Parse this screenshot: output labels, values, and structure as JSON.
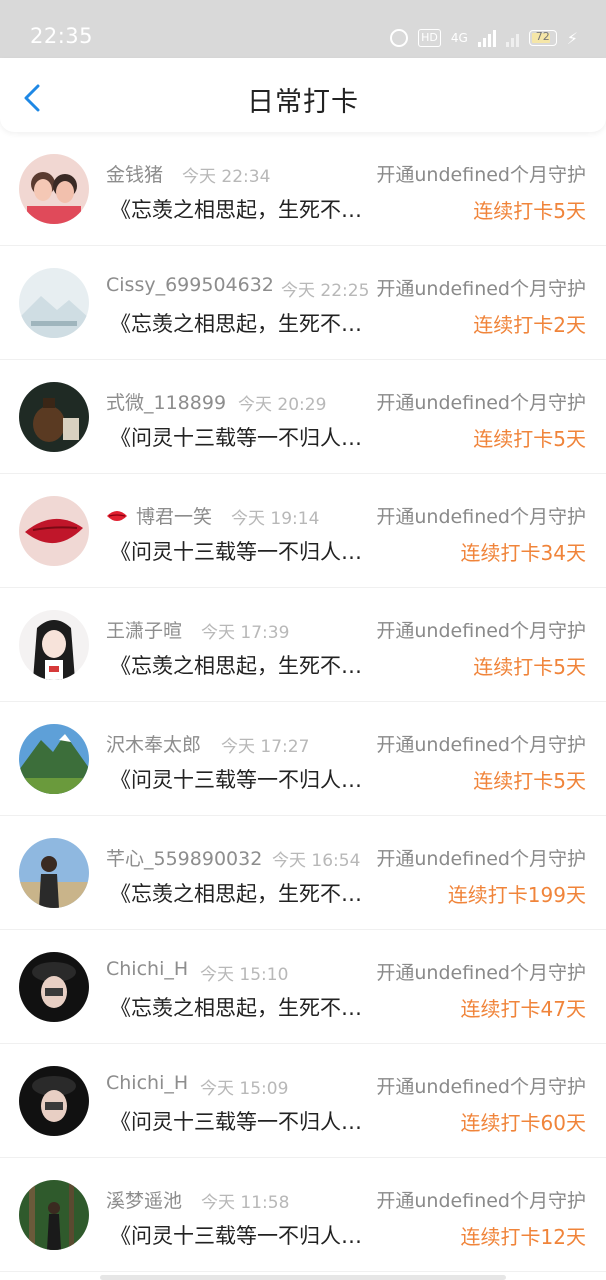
{
  "status_bar": {
    "time": "22:35",
    "hd": "HD",
    "network": "4G",
    "battery": "72"
  },
  "header": {
    "title": "日常打卡"
  },
  "entries": [
    {
      "name": "金钱猪",
      "time": "今天 22:34",
      "guard": "开通undefined个月守护",
      "content": "《忘羡之相思起，生死不…",
      "streak": "连续打卡5天"
    },
    {
      "name": "Cissy_699504632",
      "time": "今天 22:25",
      "guard": "开通undefined个月守护",
      "content": "《忘羡之相思起，生死不…",
      "streak": "连续打卡2天"
    },
    {
      "name": "式微_118899",
      "time": "今天 20:29",
      "guard": "开通undefined个月守护",
      "content": "《问灵十三载等一不归人…",
      "streak": "连续打卡5天"
    },
    {
      "name": "博君一笑",
      "time": "今天 19:14",
      "guard": "开通undefined个月守护",
      "content": "《问灵十三载等一不归人…",
      "streak": "连续打卡34天"
    },
    {
      "name": "王潇子暄",
      "time": "今天 17:39",
      "guard": "开通undefined个月守护",
      "content": "《忘羡之相思起，生死不…",
      "streak": "连续打卡5天"
    },
    {
      "name": "沢木奉太郎",
      "time": "今天 17:27",
      "guard": "开通undefined个月守护",
      "content": "《问灵十三载等一不归人…",
      "streak": "连续打卡5天"
    },
    {
      "name": "芊心_559890032",
      "time": "今天 16:54",
      "guard": "开通undefined个月守护",
      "content": "《忘羡之相思起，生死不…",
      "streak": "连续打卡199天"
    },
    {
      "name": "Chichi_H",
      "time": "今天 15:10",
      "guard": "开通undefined个月守护",
      "content": "《忘羡之相思起，生死不…",
      "streak": "连续打卡47天"
    },
    {
      "name": "Chichi_H",
      "time": "今天 15:09",
      "guard": "开通undefined个月守护",
      "content": "《问灵十三载等一不归人…",
      "streak": "连续打卡60天"
    },
    {
      "name": "溪梦遥池",
      "time": "今天 11:58",
      "guard": "开通undefined个月守护",
      "content": "《问灵十三载等一不归人…",
      "streak": "连续打卡12天"
    }
  ],
  "colors": {
    "accent": "#1e88e5",
    "streak": "#f0843a",
    "muted": "#8d8d8d"
  }
}
